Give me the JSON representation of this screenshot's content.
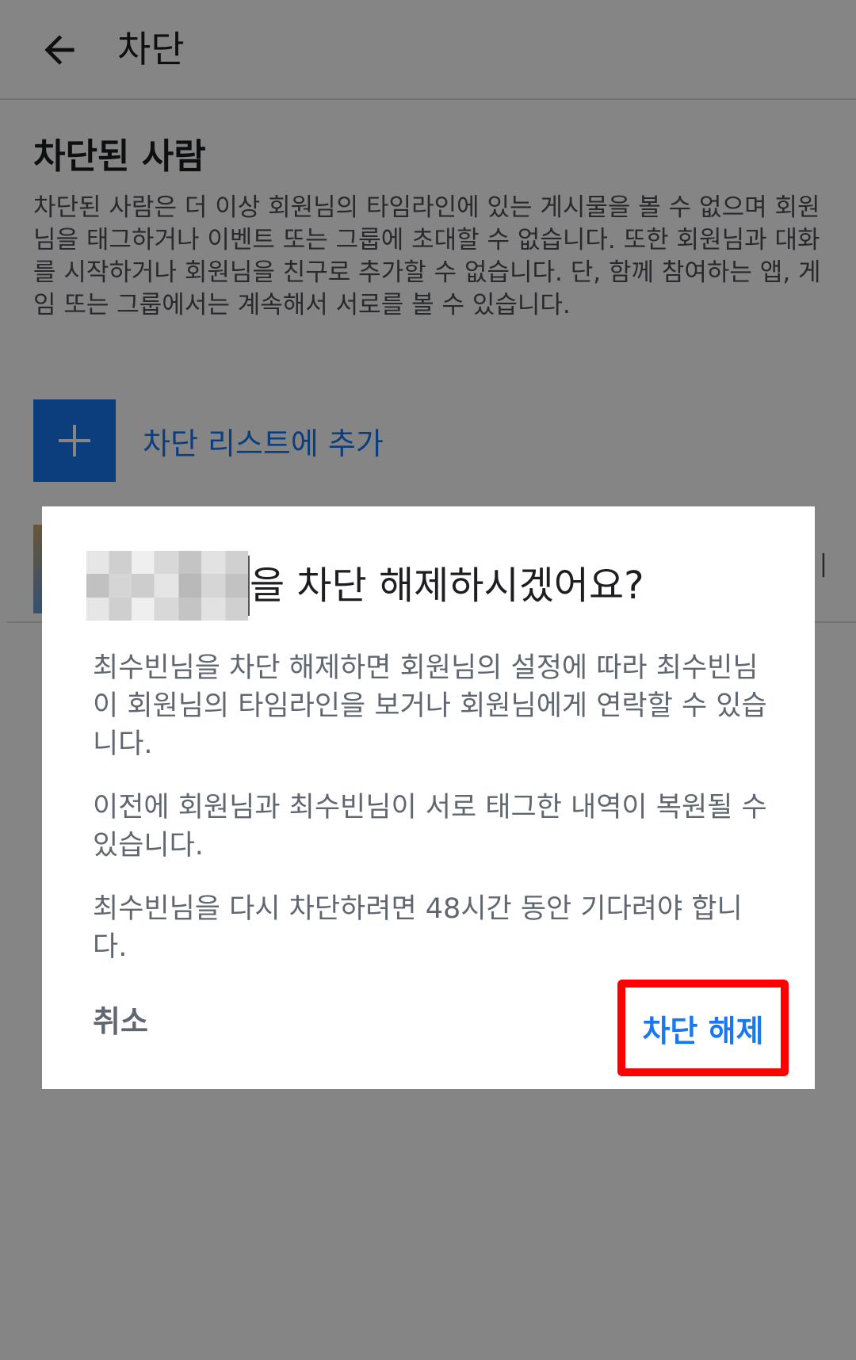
{
  "app_bar": {
    "back_icon": "arrow-left-icon",
    "title": "차단"
  },
  "blocked_section": {
    "title": "차단된 사람",
    "description": "차단된 사람은 더 이상 회원님의 타임라인에 있는 게시물을 볼 수 없으며 회원님을 태그하거나 이벤트 또는 그룹에 초대할 수 없습니다. 또한 회원님과 대화를 시작하거나 회원님을 친구로 추가할 수 없습니다. 단, 함께 참여하는 앱, 게임 또는 그룹에서는 계속해서 서로를 볼 수 있습니다.",
    "add_icon": "plus-icon",
    "add_label": "차단 리스트에 추가"
  },
  "dialog": {
    "title_suffix": "을 차단 해제하시겠어요?",
    "paragraphs": [
      "최수빈님을 차단 해제하면 회원님의 설정에 따라 최수빈님이 회원님의 타임라인을 보거나 회원님에게 연락할 수 있습니다.",
      "이전에 회원님과 최수빈님이 서로 태그한 내역이 복원될 수 있습니다.",
      "최수빈님을 다시 차단하려면 48시간 동안 기다려야 합니다."
    ],
    "cancel_label": "취소",
    "confirm_label": "차단 해제"
  },
  "colors": {
    "accent": "#1877f2",
    "highlight": "#ff0000",
    "scrim": "rgba(0,0,0,0.48)"
  }
}
